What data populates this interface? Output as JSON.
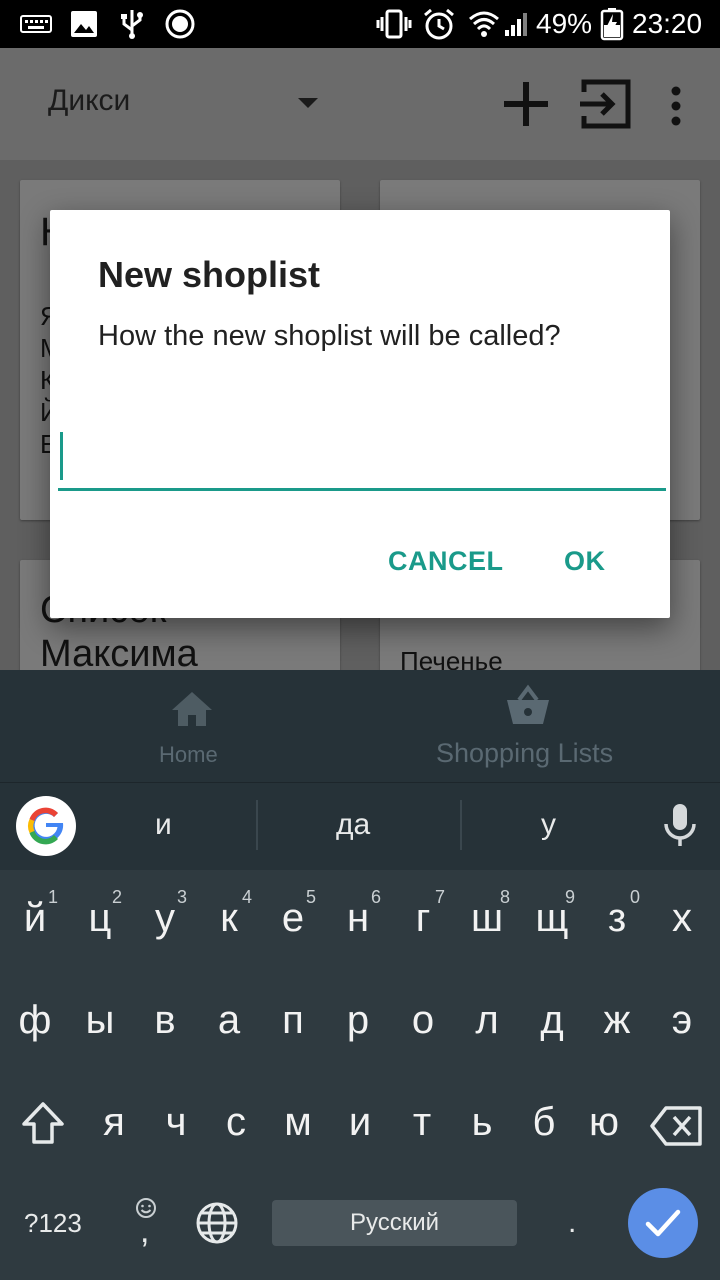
{
  "status_bar": {
    "battery_percent": "49%",
    "time": "23:20"
  },
  "app_bar": {
    "store_name": "Дикси"
  },
  "background_cards": {
    "card_top_left_text": "Н",
    "card_top_left_lines": [
      "Я",
      "М",
      "К",
      "Й",
      "Е"
    ],
    "card_bottom_left_title": "Список Максима",
    "card_bottom_right_text": "Печенье"
  },
  "dialog": {
    "title": "New shoplist",
    "message": "How the new shoplist will be called?",
    "input_value": "",
    "cancel_label": "CANCEL",
    "ok_label": "OK",
    "accent_color": "#1a9a8a"
  },
  "bottom_nav": {
    "home_label": "Home",
    "lists_label": "Shopping Lists"
  },
  "keyboard": {
    "suggestions": [
      "и",
      "да",
      "у"
    ],
    "row1": [
      {
        "key": "й",
        "hint": "1"
      },
      {
        "key": "ц",
        "hint": "2"
      },
      {
        "key": "у",
        "hint": "3"
      },
      {
        "key": "к",
        "hint": "4"
      },
      {
        "key": "е",
        "hint": "5"
      },
      {
        "key": "н",
        "hint": "6"
      },
      {
        "key": "г",
        "hint": "7"
      },
      {
        "key": "ш",
        "hint": "8"
      },
      {
        "key": "щ",
        "hint": "9"
      },
      {
        "key": "з",
        "hint": "0"
      },
      {
        "key": "х",
        "hint": ""
      }
    ],
    "row2": [
      "ф",
      "ы",
      "в",
      "а",
      "п",
      "р",
      "о",
      "л",
      "д",
      "ж",
      "э"
    ],
    "row3": [
      "я",
      "ч",
      "с",
      "м",
      "и",
      "т",
      "ь",
      "б",
      "ю"
    ],
    "symbols_label": "?123",
    "comma_label": ",",
    "period_label": ".",
    "space_label": "Русский",
    "enter_color": "#5b8ee6"
  }
}
